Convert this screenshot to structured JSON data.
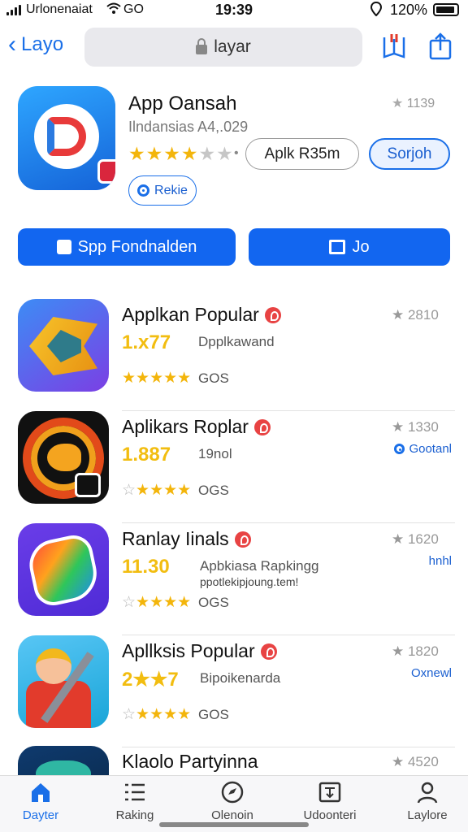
{
  "status": {
    "carrier": "Urlonenaiat",
    "network": "GO",
    "time": "19:39",
    "battery_pct": "120%"
  },
  "nav": {
    "back_label": "Layo",
    "address": "layar"
  },
  "app": {
    "name": "App Oansah",
    "subtitle": "Ilndansias A4,.029",
    "rank": "1139",
    "stars_on": "★★★★",
    "stars_off": "★★",
    "price_button": "Aplk R35m",
    "get_button": "Sorjoh",
    "secondary_button": "Rekie",
    "primary_buttons": [
      "Spp Fondnalden",
      "Jo"
    ]
  },
  "list": [
    {
      "title": "Applkan Popular",
      "rating": "1.x77",
      "desc": "Dpplkawand",
      "desc2": "",
      "stars_on": "★★★★★",
      "stars_off": "",
      "count": "GOS",
      "rank": "2810",
      "tag": ""
    },
    {
      "title": "Aplikars Roplar",
      "rating": "1.887",
      "desc": "19nol",
      "desc2": "",
      "stars_on": "★★★★",
      "stars_off": "☆",
      "count": "OGS",
      "rank": "1330",
      "tag": "Gootanl"
    },
    {
      "title": "Ranlay Iinals",
      "rating": "11.30",
      "desc": "Apbkiasa Rapkingg",
      "desc2": "ppotlekipjoung.tem!",
      "stars_on": "★★★★",
      "stars_off": "☆",
      "count": "OGS",
      "rank": "1620",
      "tag": "hnhl"
    },
    {
      "title": "Apllksis Popular",
      "rating": "2★★7",
      "desc": "Bipoikenarda",
      "desc2": "",
      "stars_on": "★★★★",
      "stars_off": "☆",
      "count": "GOS",
      "rank": "1820",
      "tag": "Oxnewl"
    },
    {
      "title": "Klaolo Partyinna",
      "rating": "",
      "desc": "",
      "desc2": "",
      "stars_on": "",
      "stars_off": "",
      "count": "",
      "rank": "4520",
      "tag": ""
    }
  ],
  "tabs": [
    {
      "label": "Dayter",
      "icon": "home-icon"
    },
    {
      "label": "Raking",
      "icon": "list-icon"
    },
    {
      "label": "Olenoin",
      "icon": "compass-icon"
    },
    {
      "label": "Udoonteri",
      "icon": "download-icon"
    },
    {
      "label": "Laylore",
      "icon": "person-icon"
    }
  ],
  "colors": {
    "accent": "#1a6fe8",
    "star": "#f3b50b",
    "badge": "#e84343"
  }
}
